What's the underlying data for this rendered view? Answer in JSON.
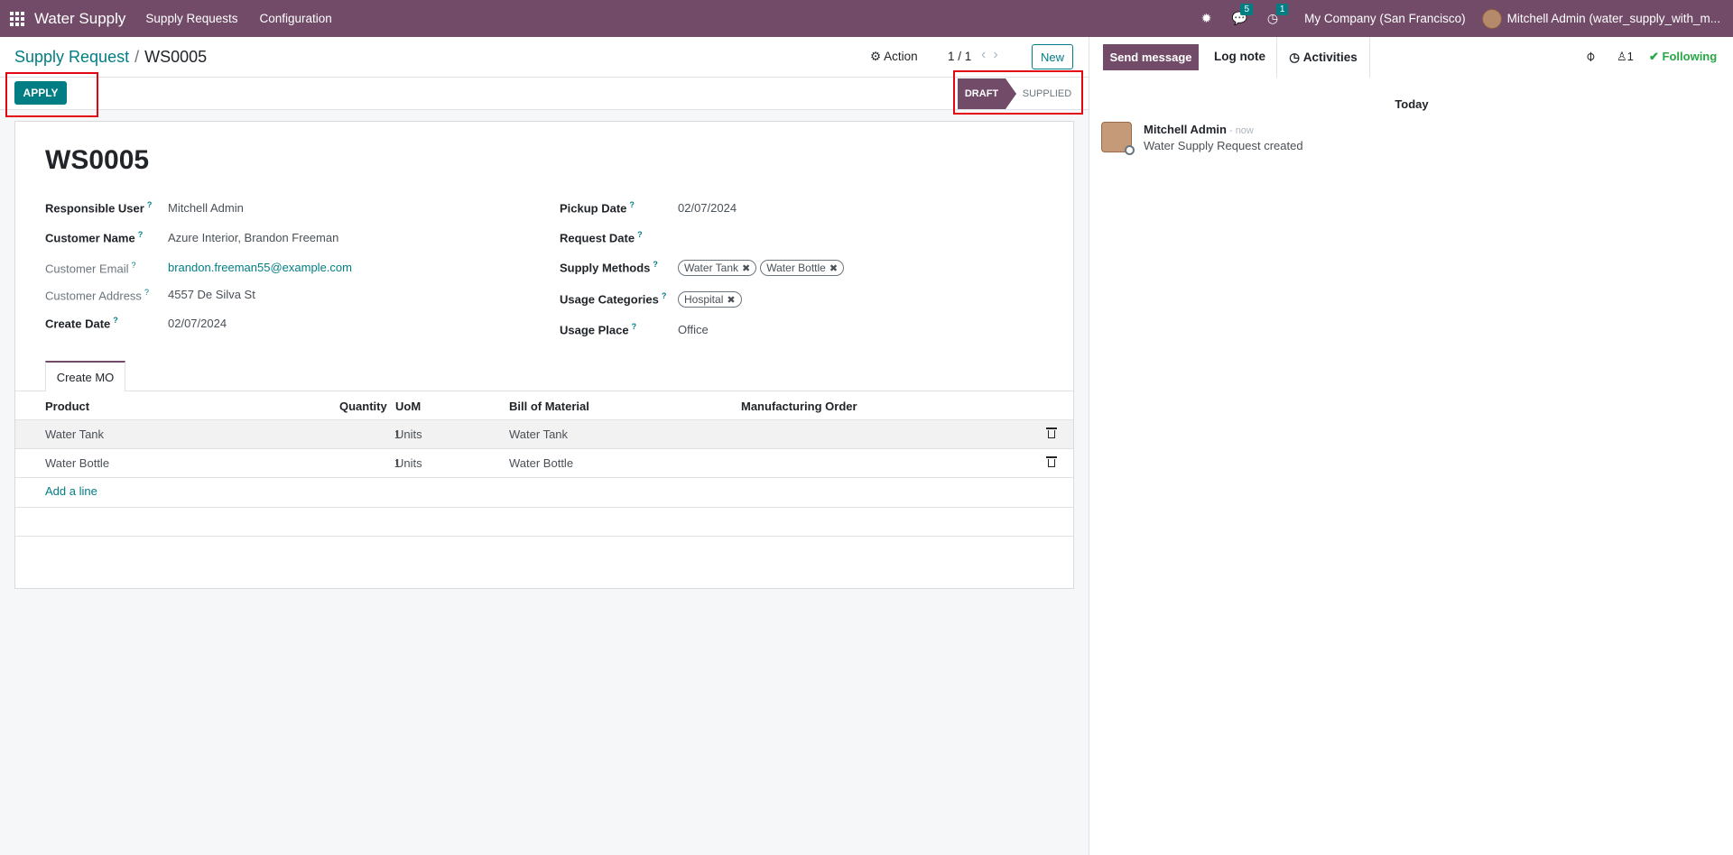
{
  "navbar": {
    "app_name": "Water Supply",
    "menus": [
      "Supply Requests",
      "Configuration"
    ],
    "messages_count": "5",
    "activities_count": "1",
    "company": "My Company (San Francisco)",
    "user": "Mitchell Admin (water_supply_with_m..."
  },
  "control": {
    "breadcrumb_parent": "Supply Request",
    "breadcrumb_separator": "/",
    "breadcrumb_current": "WS0005",
    "action_label": "Action",
    "pager": "1 / 1",
    "new_label": "New"
  },
  "statusbar": {
    "apply_label": "APPLY",
    "stages": [
      "DRAFT",
      "SUPPLIED"
    ],
    "active_stage": "DRAFT"
  },
  "form": {
    "name": "WS0005",
    "left_fields": [
      {
        "label": "Responsible User",
        "value": "Mitchell Admin",
        "help": "?"
      },
      {
        "label": "Customer Name",
        "value": "Azure Interior, Brandon Freeman",
        "help": "?"
      },
      {
        "label": "Customer Email",
        "value": "brandon.freeman55@example.com",
        "help": "?"
      },
      {
        "label": "Customer Address",
        "value": "4557 De Silva St",
        "help": "?"
      },
      {
        "label": "Create Date",
        "value": "02/07/2024",
        "help": "?"
      }
    ],
    "right_fields": {
      "pickup_date": {
        "label": "Pickup Date",
        "value": "02/07/2024",
        "help": "?"
      },
      "request_date": {
        "label": "Request Date",
        "value": "",
        "help": "?"
      },
      "supply_methods": {
        "label": "Supply Methods",
        "help": "?",
        "tags": [
          "Water Tank",
          "Water Bottle"
        ]
      },
      "usage_categories": {
        "label": "Usage Categories",
        "help": "?",
        "tags": [
          "Hospital"
        ]
      },
      "usage_place": {
        "label": "Usage Place",
        "value": "Office",
        "help": "?"
      }
    },
    "tab": "Create MO",
    "table": {
      "headers": {
        "product": "Product",
        "quantity": "Quantity",
        "uom": "UoM",
        "bom": "Bill of Material",
        "mo": "Manufacturing Order"
      },
      "rows": [
        {
          "product": "Water Tank",
          "quantity": "1",
          "uom": "Units",
          "bom": "Water Tank",
          "mo": ""
        },
        {
          "product": "Water Bottle",
          "quantity": "1",
          "uom": "Units",
          "bom": "Water Bottle",
          "mo": ""
        }
      ],
      "add_line": "Add a line"
    }
  },
  "chatter": {
    "send_message": "Send message",
    "log_note": "Log note",
    "activities": "Activities",
    "followers_count": "1",
    "following": "Following",
    "date_separator": "Today",
    "message": {
      "author": "Mitchell Admin",
      "time": "- now",
      "body": "Water Supply Request created"
    }
  },
  "colors": {
    "brand": "#714b67",
    "accent": "#017e84",
    "following": "#28a745",
    "highlight": "#e30613"
  }
}
